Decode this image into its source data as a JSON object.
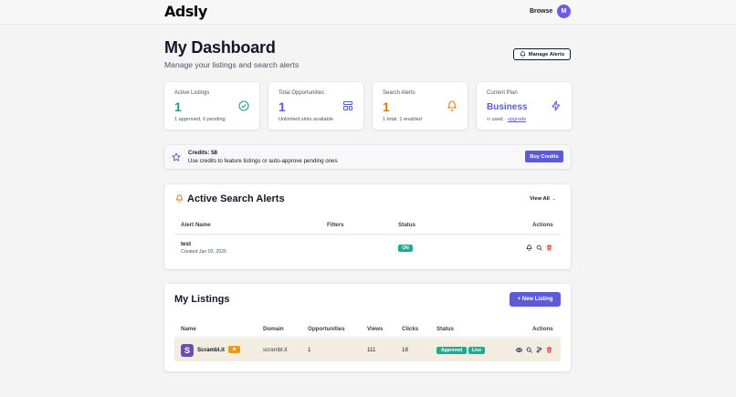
{
  "header": {
    "logo": "Adsly",
    "browse_label": "Browse",
    "avatar_initial": "M"
  },
  "page": {
    "title": "My Dashboard",
    "subtitle": "Manage your listings and search alerts",
    "manage_alerts_label": "Manage Alerts"
  },
  "stats": [
    {
      "label": "Active Listings",
      "value": "1",
      "sub": "1 approved, 0 pending",
      "color": "#1f9e8a",
      "icon": "check-circle-icon"
    },
    {
      "label": "Total Opportunities",
      "value": "1",
      "sub": "Unlimited slots available",
      "color": "#5b5bd6",
      "icon": "layout-icon"
    },
    {
      "label": "Search Alerts",
      "value": "1",
      "sub": "1 total, 1 enabled",
      "color": "#d97706",
      "icon": "bell-icon"
    },
    {
      "label": "Current Plan",
      "value": "Business",
      "sub_prefix": "∞ used · ",
      "sub_link": "upgrade",
      "color": "#5b5bd6",
      "icon": "lightning-icon"
    }
  ],
  "credits": {
    "title": "Credits: 58",
    "description": "Use credits to feature listings or auto-approve pending ones",
    "button": "Buy Credits"
  },
  "alerts": {
    "title": "Active Search Alerts",
    "view_all": "View All →",
    "columns": [
      "Alert Name",
      "Filters",
      "Status",
      "Actions"
    ],
    "rows": [
      {
        "name": "test",
        "created": "Created Jan 03, 2026",
        "filters": "",
        "status": "ON"
      }
    ]
  },
  "listings": {
    "title": "My Listings",
    "new_button": "+ New Listing",
    "columns": [
      "Name",
      "Domain",
      "Opportunities",
      "Views",
      "Clicks",
      "Status",
      "Actions"
    ],
    "rows": [
      {
        "icon_letter": "S",
        "name": "Scrambl.it",
        "featured_star": "★",
        "domain": "scrambl.it",
        "opportunities": "1",
        "views": "111",
        "clicks": "18",
        "status_approved": "Approved",
        "status_live": "Live"
      }
    ]
  },
  "colors": {
    "accent": "#5b5bd6",
    "teal": "#1f9e8a",
    "orange": "#d97706",
    "red": "#dc2626"
  }
}
